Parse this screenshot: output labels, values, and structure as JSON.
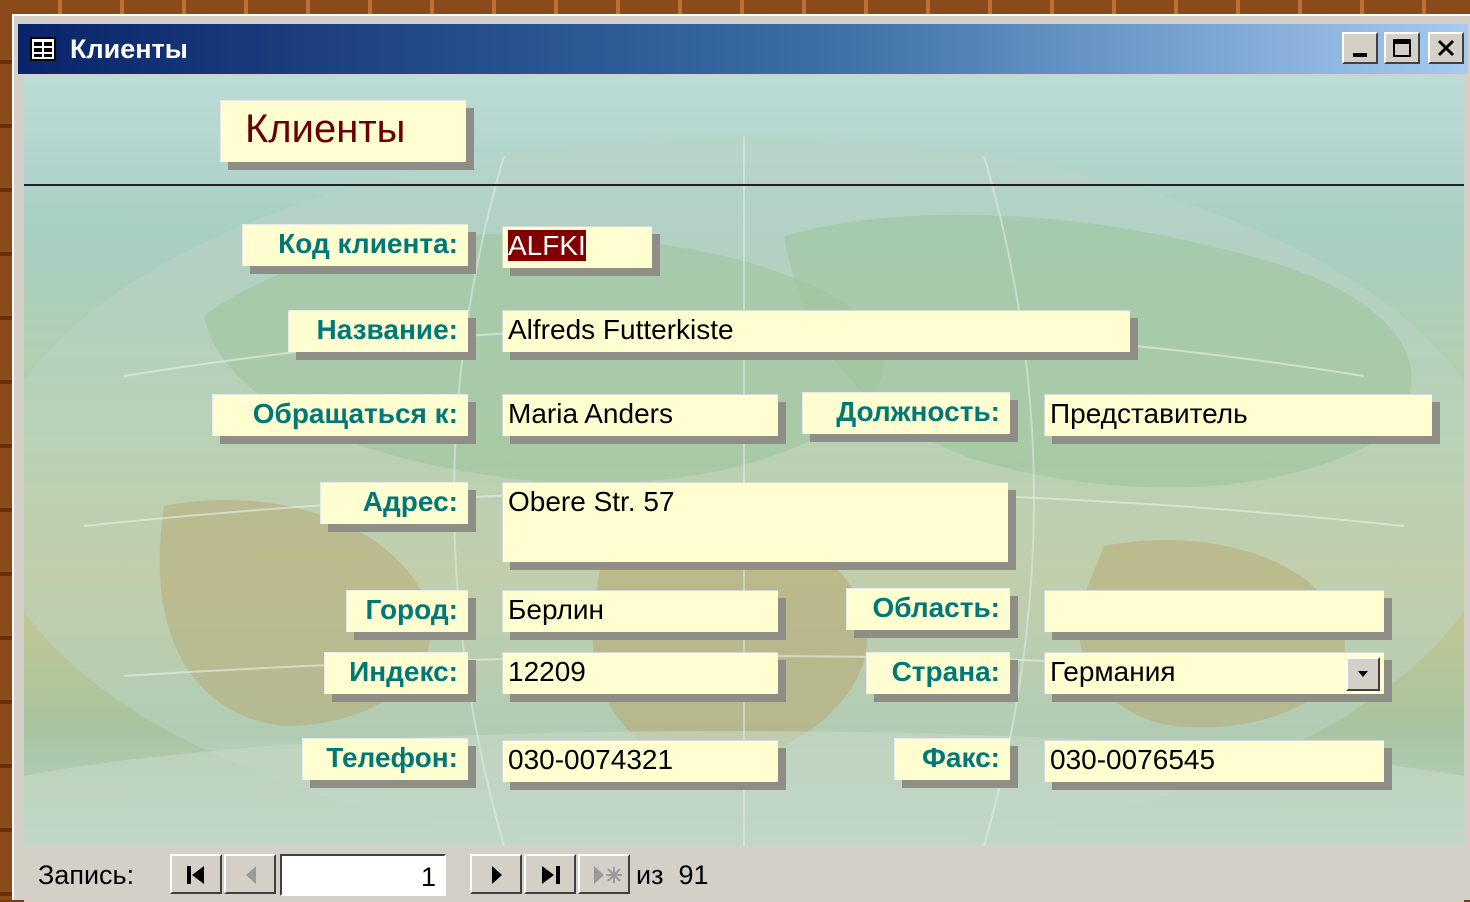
{
  "window": {
    "title": "Клиенты"
  },
  "form": {
    "heading": "Клиенты",
    "fields": {
      "customer_id": {
        "label": "Код клиента:",
        "value": "ALFKI"
      },
      "company_name": {
        "label": "Название:",
        "value": "Alfreds Futterkiste"
      },
      "contact_name": {
        "label": "Обращаться к:",
        "value": "Maria Anders"
      },
      "contact_title": {
        "label": "Должность:",
        "value": "Представитель"
      },
      "address": {
        "label": "Адрес:",
        "value": "Obere Str. 57"
      },
      "city": {
        "label": "Город:",
        "value": "Берлин"
      },
      "region": {
        "label": "Область:",
        "value": ""
      },
      "postal_code": {
        "label": "Индекс:",
        "value": "12209"
      },
      "country": {
        "label": "Страна:",
        "value": "Германия"
      },
      "phone": {
        "label": "Телефон:",
        "value": "030-0074321"
      },
      "fax": {
        "label": "Факс:",
        "value": "030-0076545"
      }
    }
  },
  "navigation": {
    "label": "Запись:",
    "current": "1",
    "of_label": "из",
    "total": "91",
    "icons": [
      "first-record-icon",
      "previous-record-icon",
      "next-record-icon",
      "last-record-icon",
      "new-record-icon"
    ]
  },
  "colors": {
    "label_text": "#007878",
    "title_text": "#6b0000",
    "field_bg": "#fffed0",
    "selection": "#800000",
    "titlebar_start": "#0a246a"
  }
}
